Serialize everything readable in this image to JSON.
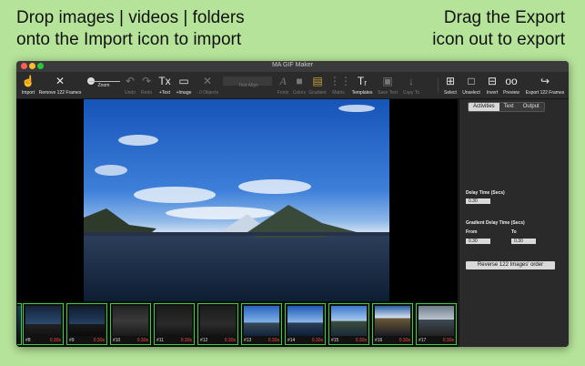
{
  "promo": {
    "left_line1": "Drop images | videos | folders",
    "left_line2": "onto the Import icon to import",
    "right_line1": "Drag the Export",
    "right_line2": "icon out to export"
  },
  "window": {
    "title": "MA GIF Maker"
  },
  "toolbar": {
    "import": "Import",
    "remove": "Remove 122 Frames",
    "zoom": "Zoom",
    "undo": "Undo",
    "redo": "Redo",
    "add_text": "+Text",
    "add_image": "+Image",
    "objects": "- 0 Objects",
    "text_align": "Text Align",
    "fonts": "Fonts",
    "colors": "Colors",
    "gradient": "Gradient",
    "matrix": "Matrix",
    "templates": "Templates",
    "save_text": "Save Text",
    "copy_to": "Copy To",
    "select": "Select",
    "unselect": "Unselect",
    "invert": "Invert",
    "preview": "Preview",
    "export": "Export 122 Frames"
  },
  "panel": {
    "tabs": [
      "Activities",
      "Text",
      "Output"
    ],
    "delay_time_label": "Delay Time (Secs)",
    "delay_time_value": "0.30",
    "gradient_label": "Gradient Delay Time (Secs)",
    "from_label": "From",
    "to_label": "To",
    "from_value": "0.30",
    "to_value": "0.30",
    "reverse_button": "Reverse 122 Images' order"
  },
  "filmstrip": [
    {
      "num": "#8",
      "delay": "0.30s"
    },
    {
      "num": "#9",
      "delay": "0.30s"
    },
    {
      "num": "#10",
      "delay": "0.30s"
    },
    {
      "num": "#11",
      "delay": "0.30s"
    },
    {
      "num": "#12",
      "delay": "0.30s"
    },
    {
      "num": "#13",
      "delay": "0.30s"
    },
    {
      "num": "#14",
      "delay": "0.30s"
    },
    {
      "num": "#15",
      "delay": "0.30s"
    },
    {
      "num": "#16",
      "delay": "0.30s"
    },
    {
      "num": "#17",
      "delay": "0.30s"
    }
  ]
}
